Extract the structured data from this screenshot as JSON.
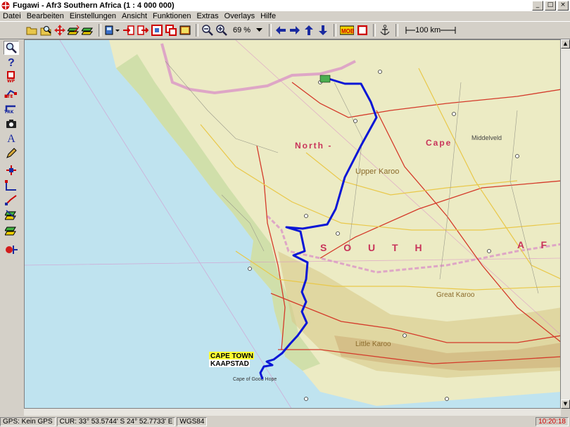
{
  "window": {
    "title": "Fugawi - Afr3  Southern Africa  (1 : 4 000 000)",
    "minimize_glyph": "_",
    "maximize_glyph": "□",
    "close_glyph": "×"
  },
  "menu": {
    "items": [
      {
        "label": "Datei"
      },
      {
        "label": "Bearbeiten"
      },
      {
        "label": "Einstellungen"
      },
      {
        "label": "Ansicht"
      },
      {
        "label": "Funktionen"
      },
      {
        "label": "Extras"
      },
      {
        "label": "Overlays"
      },
      {
        "label": "Hilfe"
      }
    ]
  },
  "toolbar": {
    "zoom_value": "69 %",
    "scale_label": "100 km"
  },
  "left_tools": {
    "wp_label": "WP",
    "rte_label": "RTE",
    "trk_label": "TRK",
    "text_tool_glyph": "A"
  },
  "map": {
    "labels": {
      "north": "North -",
      "cape": "Cape",
      "upper_karoo": "Upper Karoo",
      "south": "S O U T H",
      "south_af": "A F",
      "cape_town": "CAPE TOWN",
      "kaapstad": "KAAPSTAD",
      "middelveld": "Middelveld",
      "great_karoo": "Great Karoo",
      "little_karoo": "Little Karoo",
      "cape_good_hope": "Cape of Good Hope"
    },
    "colors": {
      "land": "#ecebc4",
      "ocean": "#bfe3ef",
      "route": "#0a16d6",
      "road_red": "#d43a2a",
      "road_yellow": "#e9c84a",
      "border_pink": "#d889c8"
    }
  },
  "status": {
    "gps": "GPS: Kein GPS",
    "cursor": "CUR: 33° 53.5744' S 24° 52.7733' E",
    "datum": "WGS84",
    "time": "10:20:18"
  }
}
